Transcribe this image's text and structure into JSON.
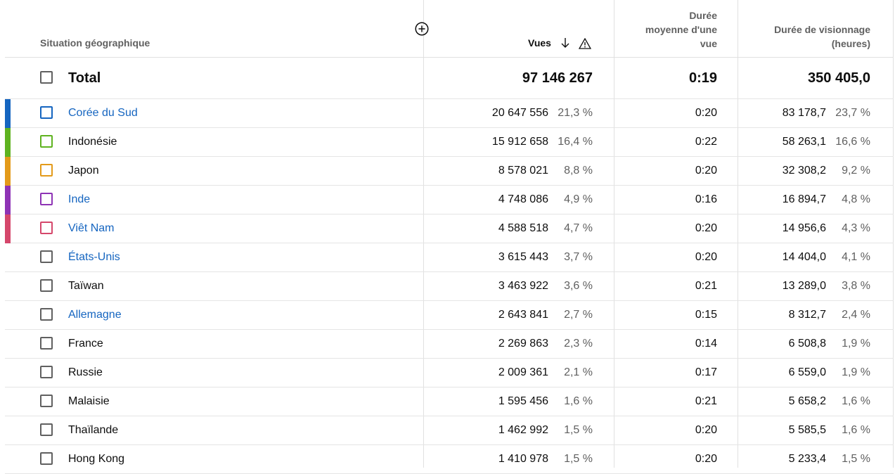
{
  "header": {
    "geo_label": "Situation géographique",
    "views_label": "Vues",
    "avg_label_lines": [
      "Durée",
      "moyenne d'une",
      "vue"
    ],
    "watch_label_lines": [
      "Durée de visionnage",
      "(heures)"
    ]
  },
  "total": {
    "label": "Total",
    "views": "97 146 267",
    "avg": "0:19",
    "watch": "350 405,0"
  },
  "rows": [
    {
      "name": "Corée du Sud",
      "link": true,
      "color": "#1565c0",
      "views": "20 647 556",
      "views_pct": "21,3 %",
      "avg": "0:20",
      "watch": "83 178,7",
      "watch_pct": "23,7 %"
    },
    {
      "name": "Indonésie",
      "link": false,
      "color": "#5fb320",
      "views": "15 912 658",
      "views_pct": "16,4 %",
      "avg": "0:22",
      "watch": "58 263,1",
      "watch_pct": "16,6 %"
    },
    {
      "name": "Japon",
      "link": false,
      "color": "#e39a1a",
      "views": "8 578 021",
      "views_pct": "8,8 %",
      "avg": "0:20",
      "watch": "32 308,2",
      "watch_pct": "9,2 %"
    },
    {
      "name": "Inde",
      "link": true,
      "color": "#8e33b5",
      "views": "4 748 086",
      "views_pct": "4,9 %",
      "avg": "0:16",
      "watch": "16 894,7",
      "watch_pct": "4,8 %"
    },
    {
      "name": "Viêt Nam",
      "link": true,
      "color": "#d5476b",
      "views": "4 588 518",
      "views_pct": "4,7 %",
      "avg": "0:20",
      "watch": "14 956,6",
      "watch_pct": "4,3 %"
    },
    {
      "name": "États-Unis",
      "link": true,
      "color": "",
      "views": "3 615 443",
      "views_pct": "3,7 %",
      "avg": "0:20",
      "watch": "14 404,0",
      "watch_pct": "4,1 %"
    },
    {
      "name": "Taïwan",
      "link": false,
      "color": "",
      "views": "3 463 922",
      "views_pct": "3,6 %",
      "avg": "0:21",
      "watch": "13 289,0",
      "watch_pct": "3,8 %"
    },
    {
      "name": "Allemagne",
      "link": true,
      "color": "",
      "views": "2 643 841",
      "views_pct": "2,7 %",
      "avg": "0:15",
      "watch": "8 312,7",
      "watch_pct": "2,4 %"
    },
    {
      "name": "France",
      "link": false,
      "color": "",
      "views": "2 269 863",
      "views_pct": "2,3 %",
      "avg": "0:14",
      "watch": "6 508,8",
      "watch_pct": "1,9 %"
    },
    {
      "name": "Russie",
      "link": false,
      "color": "",
      "views": "2 009 361",
      "views_pct": "2,1 %",
      "avg": "0:17",
      "watch": "6 559,0",
      "watch_pct": "1,9 %"
    },
    {
      "name": "Malaisie",
      "link": false,
      "color": "",
      "views": "1 595 456",
      "views_pct": "1,6 %",
      "avg": "0:21",
      "watch": "5 658,2",
      "watch_pct": "1,6 %"
    },
    {
      "name": "Thaïlande",
      "link": false,
      "color": "",
      "views": "1 462 992",
      "views_pct": "1,5 %",
      "avg": "0:20",
      "watch": "5 585,5",
      "watch_pct": "1,6 %"
    },
    {
      "name": "Hong Kong",
      "link": false,
      "color": "",
      "views": "1 410 978",
      "views_pct": "1,5 %",
      "avg": "0:20",
      "watch": "5 233,4",
      "watch_pct": "1,5 %"
    }
  ]
}
